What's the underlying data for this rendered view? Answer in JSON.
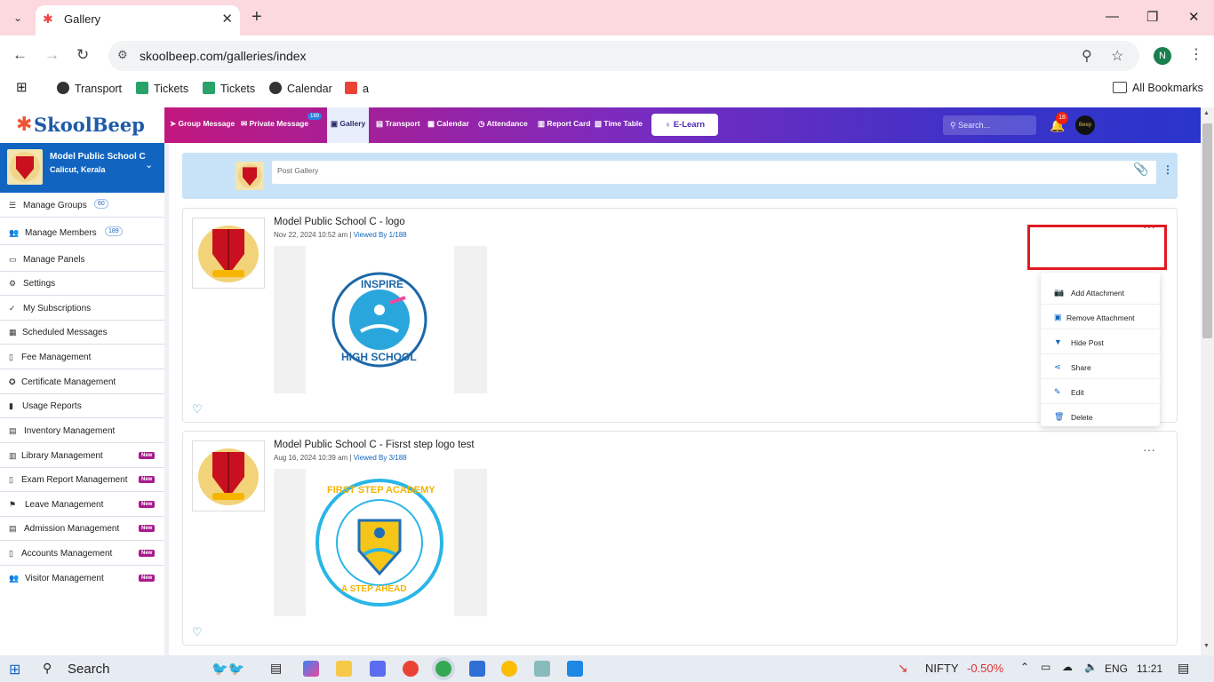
{
  "browser": {
    "tab_title": "Gallery",
    "url": "skoolbeep.com/galleries/index",
    "profile_initial": "N",
    "bookmarks": [
      {
        "label": "Transport"
      },
      {
        "label": "Tickets"
      },
      {
        "label": "Tickets"
      },
      {
        "label": "Calendar"
      },
      {
        "label": "a"
      }
    ],
    "all_bookmarks": "All Bookmarks"
  },
  "app": {
    "logo": "SkoolBeep",
    "nav": [
      {
        "label": "Group Message"
      },
      {
        "label": "Private Message"
      },
      {
        "label": "Gallery"
      },
      {
        "label": "Transport"
      },
      {
        "label": "Calendar"
      },
      {
        "label": "Attendance"
      },
      {
        "label": "Report Card"
      },
      {
        "label": "Time Table"
      }
    ],
    "private_badge": "189",
    "elearn": "E-Learn",
    "search_placeholder": "Search...",
    "notif_count": "18",
    "avatar_text": "Beep"
  },
  "sidebar": {
    "school_name": "Model Public School C",
    "school_location": "Calicut, Kerala",
    "items": [
      {
        "label": "Manage Groups",
        "count": "60"
      },
      {
        "label": "Manage Members",
        "count": "189"
      },
      {
        "label": "Manage Panels"
      },
      {
        "label": "Settings"
      },
      {
        "label": "My Subscriptions"
      },
      {
        "label": "Scheduled Messages"
      },
      {
        "label": "Fee Management"
      },
      {
        "label": "Certificate Management"
      },
      {
        "label": "Usage Reports"
      },
      {
        "label": "Inventory Management"
      },
      {
        "label": "Library Management",
        "badge": "New"
      },
      {
        "label": "Exam Report Management",
        "badge": "New"
      },
      {
        "label": "Leave Management",
        "badge": "New"
      },
      {
        "label": "Admission Management",
        "badge": "New"
      },
      {
        "label": "Accounts Management",
        "badge": "New"
      },
      {
        "label": "Visitor Management",
        "badge": "New"
      }
    ]
  },
  "main": {
    "post_gallery_placeholder": "Post Gallery",
    "posts": [
      {
        "title": "Model Public School C - logo",
        "date": "Nov 22, 2024 10:52 am",
        "viewed": "Viewed By 1/188",
        "image_text_top": "INSPIRE",
        "image_text_bottom": "HIGH SCHOOL"
      },
      {
        "title": "Model Public School C - Fisrst step logo test",
        "date": "Aug 16, 2024 10:39 am",
        "viewed": "Viewed By 3/188",
        "image_text_top": "FIRST STEP ACADEMY",
        "image_text_bottom": "A STEP AHEAD"
      }
    ],
    "menu": [
      {
        "label": "Add Attachment"
      },
      {
        "label": "Remove Attachment"
      },
      {
        "label": "Hide Post"
      },
      {
        "label": "Share"
      },
      {
        "label": "Edit"
      },
      {
        "label": "Delete"
      }
    ]
  },
  "taskbar": {
    "search": "Search",
    "ticker": "NIFTY",
    "ticker_change": "-0.50%",
    "lang": "ENG",
    "time": "11:21"
  }
}
